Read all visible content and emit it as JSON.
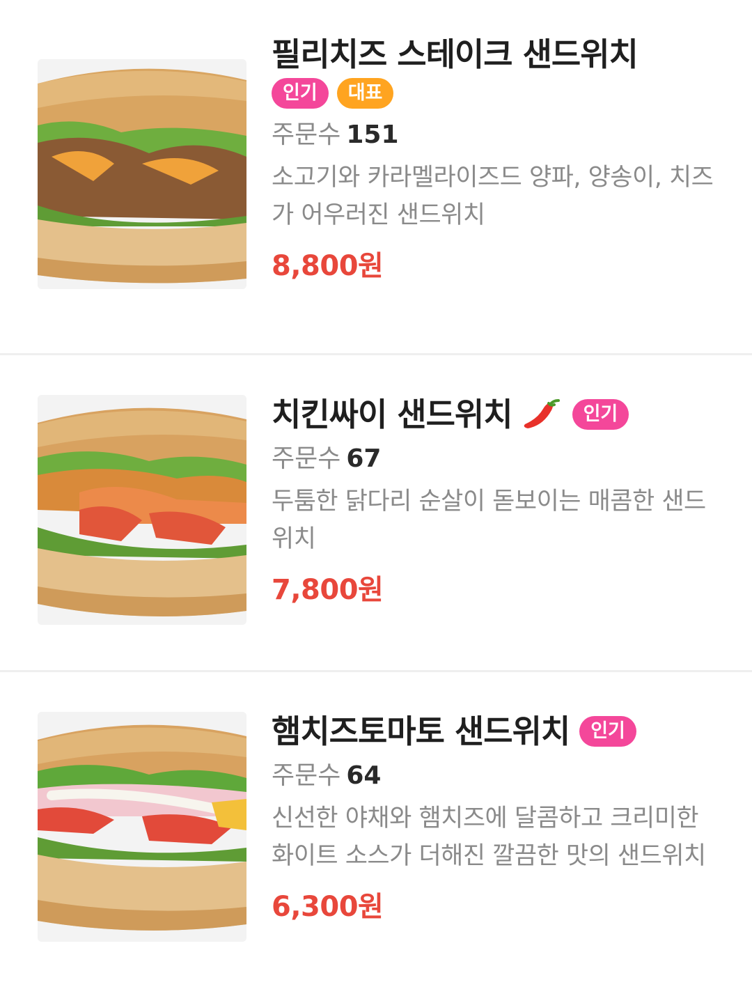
{
  "menu_items": [
    {
      "title": "필리치즈 스테이크 샌드위치",
      "badges": [
        "인기",
        "대표"
      ],
      "orders_label": "주문수",
      "orders_count": "151",
      "description": "소고기와 카라멜라이즈드 양파, 양송이, 치즈가 어우러진 샌드위치",
      "price": "8,800원",
      "image_icon": "philly-cheese-steak-sandwich-image"
    },
    {
      "title": "치킨싸이 샌드위치",
      "badges": [
        "인기"
      ],
      "spicy_icon": "chili-pepper-icon",
      "orders_label": "주문수",
      "orders_count": "67",
      "description": "두툼한 닭다리 순살이 돋보이는 매콤한 샌드위치",
      "price": "7,800원",
      "image_icon": "chicken-thigh-sandwich-image"
    },
    {
      "title": "햄치즈토마토 샌드위치",
      "badges": [
        "인기"
      ],
      "orders_label": "주문수",
      "orders_count": "64",
      "description": "신선한 야채와 햄치즈에 달콤하고 크리미한 화이트 소스가 더해진 깔끔한 맛의 샌드위치",
      "price": "6,300원",
      "image_icon": "ham-cheese-tomato-sandwich-image"
    }
  ],
  "colors": {
    "badge_popular": "#f4479a",
    "badge_signature": "#ffa420",
    "price": "#e8473b",
    "muted_text": "#8a8a8a"
  }
}
